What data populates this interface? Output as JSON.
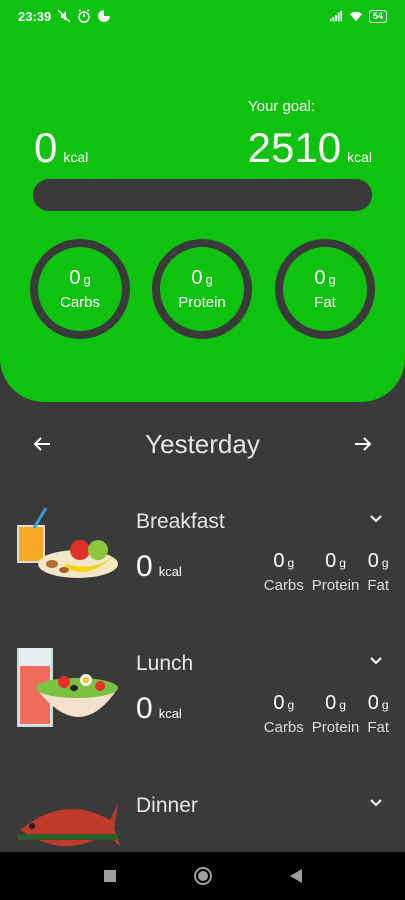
{
  "status": {
    "time": "23:39",
    "battery": "54"
  },
  "summary": {
    "goal_label": "Your goal:",
    "consumed": "0",
    "consumed_unit": "kcal",
    "goal": "2510",
    "goal_unit": "kcal",
    "progress_fraction": 0
  },
  "macros": [
    {
      "value": "0",
      "unit": "g",
      "name": "Carbs"
    },
    {
      "value": "0",
      "unit": "g",
      "name": "Protein"
    },
    {
      "value": "0",
      "unit": "g",
      "name": "Fat"
    }
  ],
  "day": {
    "title": "Yesterday"
  },
  "meals": [
    {
      "name": "Breakfast",
      "kcal": "0",
      "kcal_unit": "kcal",
      "macros": [
        {
          "value": "0",
          "unit": "g",
          "name": "Carbs"
        },
        {
          "value": "0",
          "unit": "g",
          "name": "Protein"
        },
        {
          "value": "0",
          "unit": "g",
          "name": "Fat"
        }
      ]
    },
    {
      "name": "Lunch",
      "kcal": "0",
      "kcal_unit": "kcal",
      "macros": [
        {
          "value": "0",
          "unit": "g",
          "name": "Carbs"
        },
        {
          "value": "0",
          "unit": "g",
          "name": "Protein"
        },
        {
          "value": "0",
          "unit": "g",
          "name": "Fat"
        }
      ]
    },
    {
      "name": "Dinner"
    }
  ],
  "colors": {
    "accent": "#10c210",
    "background": "#3a3a3a"
  }
}
